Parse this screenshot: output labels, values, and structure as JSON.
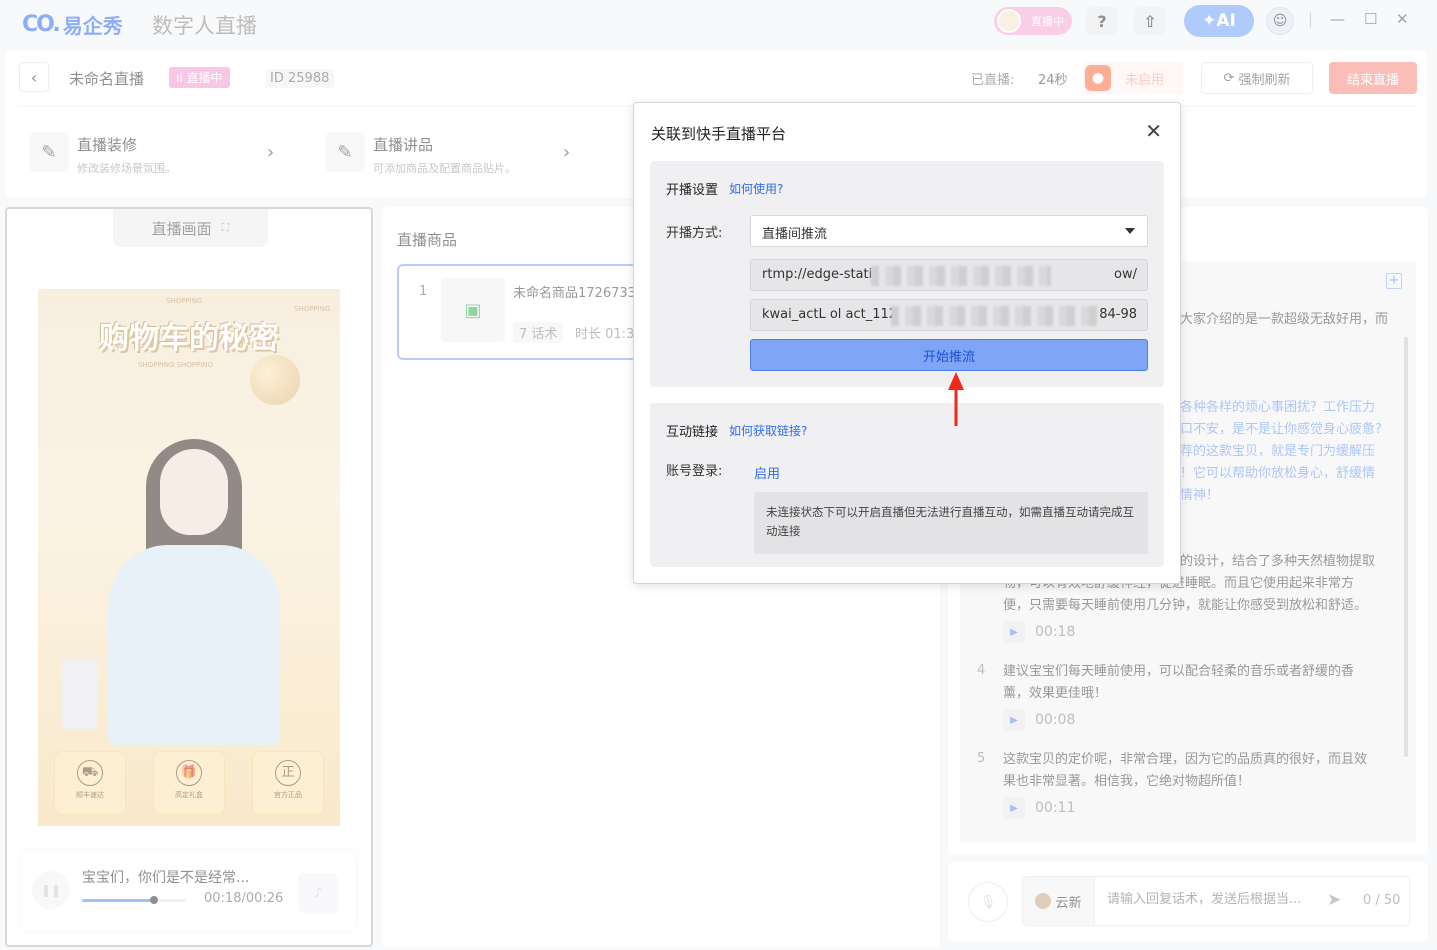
{
  "titlebar": {
    "brand": "易企秀",
    "brand_mark": "CO.",
    "app_name": "数字人直播",
    "live_status": "直播中",
    "help": "?",
    "upload": "⇧",
    "ai": "AI",
    "user_icon": "user-avatar"
  },
  "header": {
    "back": "‹",
    "title": "未命名直播",
    "live_badge": "直播中",
    "id_label": "ID",
    "id_value": "25988",
    "duration_label": "已直播:",
    "duration_value": "24秒",
    "kuaishou_status": "未启用",
    "refresh_label": "强制刷新",
    "end_label": "结束直播",
    "tools": [
      {
        "title": "直播装修",
        "desc": "修改装修场景氛围。"
      },
      {
        "title": "直播讲品",
        "desc": "可添加商品及配置商品贴片。"
      }
    ]
  },
  "preview": {
    "tab_label": "直播画面",
    "stage_title": "购物车的秘密",
    "ribbon_1": "SHOPPING",
    "ribbon_2": "SHOPPING",
    "ribbon_3": "SHOPPING  SHOPPING",
    "features": [
      {
        "icon": "⛟",
        "label": "顺丰速达"
      },
      {
        "icon": "🎁",
        "label": "高定礼盒"
      },
      {
        "icon": "正",
        "label": "官方正品"
      }
    ],
    "audio_text": "宝宝们，你们是不是经常...",
    "audio_time": "00:18/00:26",
    "audio_progress": 0.69
  },
  "goods": {
    "title": "直播商品",
    "items": [
      {
        "index": "1",
        "name": "未命名商品1726733",
        "scripts": "7 话术",
        "duration": "时长 01:3"
      }
    ]
  },
  "scripts": {
    "frag_top": "大家介绍的是一款超级无敌好用，而",
    "frag_blue": [
      "各种各样的烦心事困扰？工作压力",
      "口不安，是不是让你感觉身心疲惫?",
      "荐的这款宝贝，就是专门为缓解压",
      "！它可以帮助你放松身心，舒缓情",
      "情神！"
    ],
    "frag_3a": "的设计，结合了多种天然植物提取",
    "frag_3b": "物，可以有效地舒缓神经，促进睡眠。而且它使用起来非常方",
    "frag_3c": "便，只需要每天睡前使用几分钟，就能让你感受到放松和舒适。",
    "time_3": "00:18",
    "items": [
      {
        "index": "4",
        "line1": "建议宝宝们每天睡前使用，可以配合轻柔的音乐或者舒缓的香",
        "line2": "薰，效果更佳哦！",
        "time": "00:08"
      },
      {
        "index": "5",
        "line1": "这款宝贝的定价呢，非常合理，因为它的品质真的很好，而且效",
        "line2": "果也非常显著。相信我，它绝对物超所值！",
        "time": "00:11"
      }
    ]
  },
  "reply": {
    "user": "云新",
    "placeholder": "请输入回复话术，发送后根据当...",
    "count": "0 / 50"
  },
  "modal": {
    "title": "关联到快手直播平台",
    "close": "✕",
    "section1_title": "开播设置",
    "section1_help": "如何使用?",
    "mode_label": "开播方式:",
    "mode_value": "直播间推流",
    "rtmp_prefix": "rtmp://edge-static",
    "rtmp_suffix": "ow/",
    "key_prefix": "kwai_actL ol act_1121",
    "key_suffix": "84-98",
    "push_label": "开始推流",
    "section2_title": "互动链接",
    "section2_help": "如何获取链接?",
    "account_label": "账号登录:",
    "enable_label": "启用",
    "note": "未连接状态下可以开启直播但无法进行直播互动，如需直播互动请完成互动连接"
  },
  "colors": {
    "accent": "#2f6cf5",
    "danger": "#f8877d",
    "live": "#f59ad2",
    "arrow": "#f02a1a"
  }
}
